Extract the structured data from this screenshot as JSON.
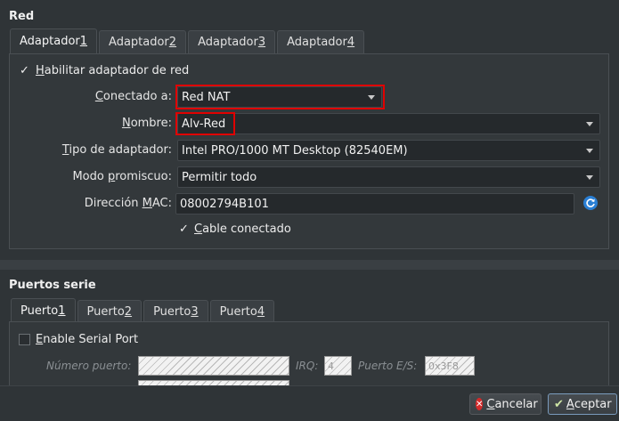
{
  "network": {
    "section_title": "Red",
    "tabs": [
      {
        "pre": "Adaptador ",
        "key": "1",
        "post": ""
      },
      {
        "pre": "Adaptador ",
        "key": "2",
        "post": ""
      },
      {
        "pre": "Adaptador ",
        "key": "3",
        "post": ""
      },
      {
        "pre": "Adaptador ",
        "key": "4",
        "post": ""
      }
    ],
    "enable_adapter": {
      "pre": "",
      "key": "H",
      "post": "abilitar adaptador de red",
      "checked": "✓"
    },
    "attached_to": {
      "label_pre": "",
      "label_key": "C",
      "label_post": "onectado a:",
      "value": "Red NAT"
    },
    "name": {
      "label_pre": "",
      "label_key": "N",
      "label_post": "ombre:",
      "value": "Alv-Red"
    },
    "adapter_type": {
      "label_pre": "",
      "label_key": "T",
      "label_post": "ipo de adaptador:",
      "value": "Intel PRO/1000 MT Desktop (82540EM)"
    },
    "promiscuous": {
      "label_pre": "Modo ",
      "label_key": "p",
      "label_post": "romiscuo:",
      "value": "Permitir todo"
    },
    "mac": {
      "label_pre": "Dirección ",
      "label_key": "M",
      "label_post": "AC:",
      "value": "08002794B101"
    },
    "cable": {
      "pre": "",
      "key": "C",
      "post": "able conectado",
      "checked": "✓"
    }
  },
  "serial": {
    "section_title": "Puertos serie",
    "tabs": [
      {
        "pre": "Puerto ",
        "key": "1",
        "post": ""
      },
      {
        "pre": "Puerto ",
        "key": "2",
        "post": ""
      },
      {
        "pre": "Puerto ",
        "key": "3",
        "post": ""
      },
      {
        "pre": "Puerto ",
        "key": "4",
        "post": ""
      }
    ],
    "enable": {
      "pre": "",
      "key": "E",
      "post": "nable Serial Port"
    },
    "port_number_label": "Número puerto:",
    "irq_label": "IRQ:",
    "io_port_label": "Puerto E/S:",
    "irq_value": "4",
    "io_port_value": "0x3F8"
  },
  "footer": {
    "cancel": {
      "pre": "",
      "key": "C",
      "post": "ancelar"
    },
    "accept": {
      "pre": "",
      "key": "A",
      "post": "ceptar"
    }
  },
  "colors": {
    "highlight": "#e00000",
    "accent": "#2a7fd4"
  }
}
